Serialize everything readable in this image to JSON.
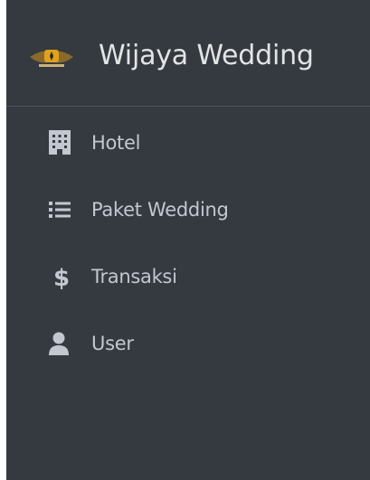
{
  "brand": {
    "name": "Wijaya Wedding",
    "logo_icon": "wedding-logo-icon"
  },
  "nav": {
    "items": [
      {
        "label": "Hotel",
        "icon": "hotel-icon"
      },
      {
        "label": "Paket Wedding",
        "icon": "list-icon"
      },
      {
        "label": "Transaksi",
        "icon": "dollar-icon"
      },
      {
        "label": "User",
        "icon": "user-icon"
      }
    ]
  },
  "colors": {
    "sidebar_bg": "#343a40",
    "text": "#c2c7d0",
    "brand_text": "#e2e4e6",
    "divider": "#4b545c"
  }
}
